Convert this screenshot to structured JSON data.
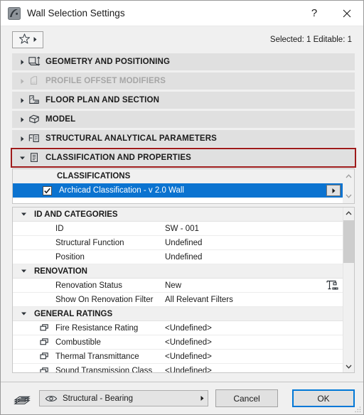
{
  "window": {
    "title": "Wall Selection Settings",
    "app_icon": "archicad-logo-icon",
    "help_label": "?",
    "close_label": "✕"
  },
  "toolbar": {
    "favorites_icon": "star-icon",
    "favorites_dropdown_icon": "triangle-right-icon",
    "selection_info": "Selected: 1 Editable: 1"
  },
  "sections": [
    {
      "label": "GEOMETRY AND POSITIONING",
      "icon": "geometry-positioning-icon",
      "expanded": false,
      "disabled": false,
      "highlighted": false
    },
    {
      "label": "PROFILE OFFSET MODIFIERS",
      "icon": "profile-offset-icon",
      "expanded": false,
      "disabled": true,
      "highlighted": false
    },
    {
      "label": "FLOOR PLAN AND SECTION",
      "icon": "floor-plan-section-icon",
      "expanded": false,
      "disabled": false,
      "highlighted": false
    },
    {
      "label": "MODEL",
      "icon": "model-box-icon",
      "expanded": false,
      "disabled": false,
      "highlighted": false
    },
    {
      "label": "STRUCTURAL ANALYTICAL PARAMETERS",
      "icon": "structural-analytical-icon",
      "expanded": false,
      "disabled": false,
      "highlighted": false
    },
    {
      "label": "CLASSIFICATION AND PROPERTIES",
      "icon": "classification-properties-icon",
      "expanded": true,
      "disabled": false,
      "highlighted": true
    }
  ],
  "classifications": {
    "header": "CLASSIFICATIONS",
    "checkbox_icon": "checkmark-icon",
    "arrow_button_icon": "triangle-right-icon",
    "items": [
      {
        "label": "Archicad Classification - v 2.0 Wall",
        "checked": true,
        "selected": true
      }
    ],
    "scroll_up_icon": "chevron-up-icon",
    "scroll_down_icon": "chevron-down-icon"
  },
  "properties": {
    "scroll_up_icon": "chevron-up-icon",
    "scroll_down_icon": "chevron-down-icon",
    "rows": [
      {
        "type": "group",
        "name": "ID AND CATEGORIES",
        "value": "",
        "expanded": true,
        "linked": false,
        "extra_icon": ""
      },
      {
        "type": "item",
        "name": "ID",
        "value": "SW - 001",
        "linked": false,
        "extra_icon": ""
      },
      {
        "type": "item",
        "name": "Structural Function",
        "value": "Undefined",
        "linked": false,
        "extra_icon": ""
      },
      {
        "type": "item",
        "name": "Position",
        "value": "Undefined",
        "linked": false,
        "extra_icon": ""
      },
      {
        "type": "group",
        "name": "RENOVATION",
        "value": "",
        "expanded": true,
        "linked": false,
        "extra_icon": ""
      },
      {
        "type": "item",
        "name": "Renovation Status",
        "value": "New",
        "linked": false,
        "extra_icon": "construction-crane-icon"
      },
      {
        "type": "item",
        "name": "Show On Renovation Filter",
        "value": "All Relevant Filters",
        "linked": false,
        "extra_icon": ""
      },
      {
        "type": "group",
        "name": "GENERAL RATINGS",
        "value": "",
        "expanded": true,
        "linked": false,
        "extra_icon": ""
      },
      {
        "type": "item",
        "name": "Fire Resistance Rating",
        "value": "<Undefined>",
        "linked": true,
        "extra_icon": ""
      },
      {
        "type": "item",
        "name": "Combustible",
        "value": "<Undefined>",
        "linked": true,
        "extra_icon": ""
      },
      {
        "type": "item",
        "name": "Thermal Transmittance",
        "value": "<Undefined>",
        "linked": true,
        "extra_icon": ""
      },
      {
        "type": "item",
        "name": "Sound Transmission Class",
        "value": "<Undefined>",
        "linked": true,
        "extra_icon": "",
        "partial": true
      }
    ]
  },
  "footer": {
    "layer_icon": "layers-stack-icon",
    "layer_eye_icon": "eye-icon",
    "layer_value": "Structural - Bearing",
    "layer_dropdown_icon": "triangle-right-icon",
    "cancel_label": "Cancel",
    "ok_label": "OK"
  },
  "colors": {
    "selection_blue": "#0b73d0",
    "highlight_red": "#9e1b1b",
    "focus_blue": "#0078d7",
    "section_bg": "#e0e0e0",
    "window_bg": "#f0f0f0"
  }
}
